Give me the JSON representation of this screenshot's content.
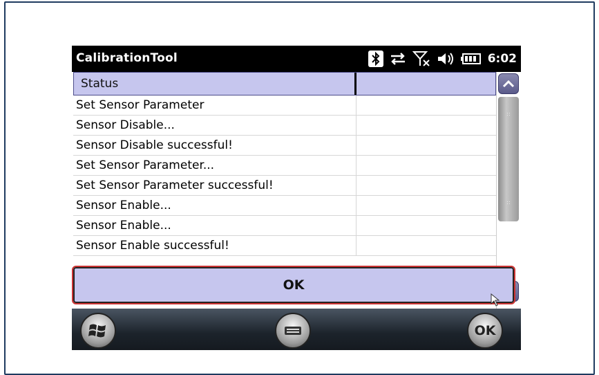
{
  "titlebar": {
    "app_title": "CalibrationTool",
    "clock": "6:02",
    "icons": [
      "bluetooth-icon",
      "data-sync-icon",
      "no-signal-icon",
      "volume-icon",
      "battery-icon"
    ]
  },
  "grid": {
    "columns": [
      "Status",
      ""
    ],
    "rows": [
      "Set Sensor Parameter",
      "Sensor Disable...",
      "Sensor Disable successful!",
      "Set Sensor Parameter...",
      "Set Sensor Parameter successful!",
      "Sensor Enable...",
      "Sensor Enable...",
      "Sensor Enable successful!"
    ]
  },
  "ok_button": {
    "label": "OK"
  },
  "taskbar": {
    "start_icon": "windows-logo-icon",
    "keyboard_icon": "keyboard-icon",
    "ok_label": "OK"
  },
  "colors": {
    "header_bg": "#c6c6ee",
    "ok_border": "#cc3333",
    "titlebar_bg": "#000000"
  }
}
